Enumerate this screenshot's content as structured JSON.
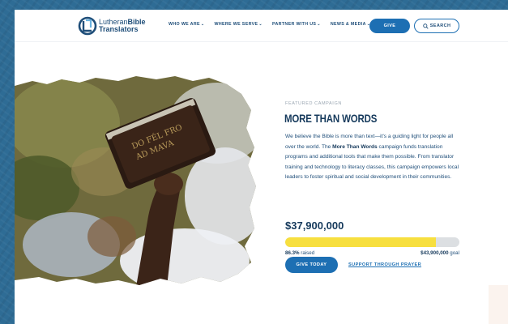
{
  "header": {
    "logo": {
      "line1_prefix": "Lutheran",
      "line1_suffix": "Bible",
      "line2": "Translators"
    },
    "nav": [
      {
        "label": "WHO WE ARE"
      },
      {
        "label": "WHERE WE SERVE"
      },
      {
        "label": "PARTNER WITH US"
      },
      {
        "label": "NEWS & MEDIA"
      }
    ],
    "give_label": "GIVE",
    "search_label": "SEARCH"
  },
  "hero": {
    "book_spine_text": [
      "DO FÉL FRO",
      "AD MAVA"
    ]
  },
  "campaign": {
    "eyebrow": "FEATURED CAMPAIGN",
    "title": "MORE THAN WORDS",
    "desc_part1": "We believe the Bible is more than text—it's a guiding light for people all over the world. The ",
    "desc_bold": "More Than Words",
    "desc_part2": " campaign funds translation programs and additional tools that make them possible. From translator training and technology to literacy classes, this campaign empowers local leaders to foster spiritual and social development in their communities.",
    "amount": "$37,900,000",
    "progress_fraction": 0.863,
    "raised_percent": "86.3%",
    "raised_label": "raised",
    "goal_amount": "$43,900,000",
    "goal_label": "goal",
    "give_today_label": "GIVE TODAY",
    "prayer_label": "SUPPORT THROUGH PRAYER"
  },
  "colors": {
    "primary_blue": "#1d6fb3",
    "navy_text": "#163a5c",
    "progress_yellow": "#f7df3f",
    "progress_track": "#dcdfe2",
    "background_blue": "#2e6c95"
  }
}
